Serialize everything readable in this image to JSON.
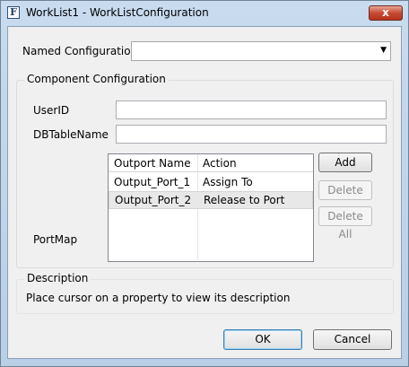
{
  "window": {
    "title": "WorkList1 - WorkListConfiguration",
    "app_icon_letter": "F",
    "close_glyph": "x"
  },
  "named_configuration": {
    "label": "Named Configuration",
    "value": "",
    "arrow_glyph": "▼"
  },
  "component_configuration": {
    "title": "Component Configuration",
    "userid": {
      "label": "UserID",
      "value": ""
    },
    "dbtablename": {
      "label": "DBTableName",
      "value": ""
    },
    "portmap": {
      "label": "PortMap",
      "columns": [
        "Outport Name",
        "Action"
      ],
      "rows": [
        {
          "name": "Output_Port_1",
          "action": "Assign To"
        },
        {
          "name": "Output_Port_2",
          "action": "Release to Port"
        }
      ],
      "buttons": {
        "add": "Add",
        "delete": "Delete",
        "delete_all": "Delete All"
      }
    }
  },
  "description": {
    "title": "Description",
    "text": "Place cursor on a property to view its description"
  },
  "footer": {
    "ok": "OK",
    "cancel": "Cancel"
  }
}
